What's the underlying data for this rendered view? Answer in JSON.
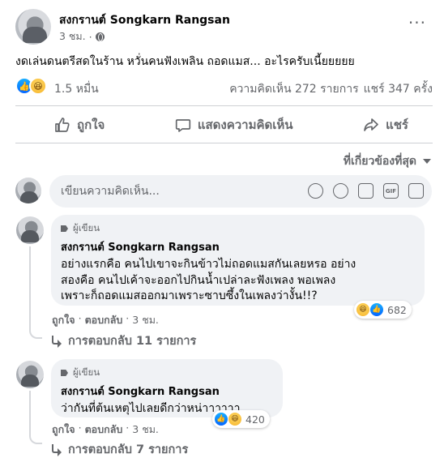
{
  "post": {
    "author": "สงกรานต์ Songkarn Rangsan",
    "time": "3 ชม.",
    "text": "งดเล่นดนตรีสดในร้าน หวั่นคนฟังเพลิน ถอดแมส... อะไรครับเนี้ยยยยย",
    "reactions_count": "1.5 หมื่น",
    "comments_count": "ความคิดเห็น 272 รายการ",
    "shares_count": "แชร์ 347 ครั้ง",
    "reaction_icons": [
      "like-icon",
      "haha-icon"
    ]
  },
  "actions": {
    "like_label": "ถูกใจ",
    "comment_label": "แสดงความคิดเห็น",
    "share_label": "แชร์"
  },
  "sort": {
    "label": "ที่เกี่ยวข้องที่สุด"
  },
  "composer": {
    "placeholder": "เขียนความคิดเห็น..."
  },
  "comments": [
    {
      "badge": "ผู้เขียน",
      "author": "สงกรานต์ Songkarn Rangsan",
      "text": "อย่างแรกคือ คนไปเขาจะกินข้าวไม่ถอดแมสกันเลยหรอ อย่าง\nสองคือ คนไปเค้าจะออกไปกินน้ำเปล่าละฟังเพลง พอเพลง\nเพราะก็ถอดแมสออกมาเพราะซาบซึ้งในเพลงว่างั้น!!?",
      "reaction_count": "682",
      "like_label": "ถูกใจ",
      "reply_label": "ตอบกลับ",
      "time": "3 ชม.",
      "replies_label": "การตอบกลับ 11 รายการ"
    },
    {
      "badge": "ผู้เขียน",
      "author": "สงกรานต์ Songkarn Rangsan",
      "text": "ว่ากันที่ต้นเหตุไปเลยดีกว่าหน่าาาาาา",
      "reaction_count": "420",
      "like_label": "ถูกใจ",
      "reply_label": "ตอบกลับ",
      "time": "3 ชม.",
      "replies_label": "การตอบกลับ 7 รายการ"
    }
  ],
  "colors": {
    "accent": "#1877f2",
    "muted": "#65676b",
    "bubble": "#f0f2f5",
    "divider": "#ced0d4"
  }
}
